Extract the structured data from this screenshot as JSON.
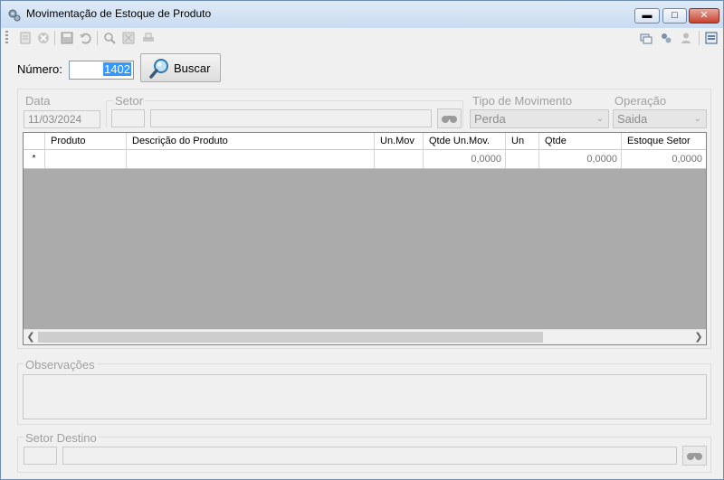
{
  "window": {
    "title": "Movimentação de Estoque de Produto"
  },
  "search": {
    "numero_label": "Número:",
    "numero_value": "1402",
    "buscar_label": "Buscar"
  },
  "header": {
    "data_label": "Data",
    "data_value": "11/03/2024",
    "setor_label": "Setor",
    "tipo_label": "Tipo de Movimento",
    "tipo_value": "Perda",
    "operacao_label": "Operação",
    "operacao_value": "Saida"
  },
  "grid": {
    "columns": [
      "Produto",
      "Descrição do Produto",
      "Un.Mov",
      "Qtde Un.Mov.",
      "Un",
      "Qtde",
      "Estoque Setor"
    ],
    "new_row_marker": "*",
    "row": {
      "qtde_un_mov": "0,0000",
      "qtde": "0,0000",
      "estoque_setor": "0,0000"
    }
  },
  "observacoes": {
    "label": "Observações"
  },
  "setor_destino": {
    "label": "Setor Destino"
  },
  "colors": {
    "accent": "#3399ff",
    "grid_bg": "#ababab"
  }
}
